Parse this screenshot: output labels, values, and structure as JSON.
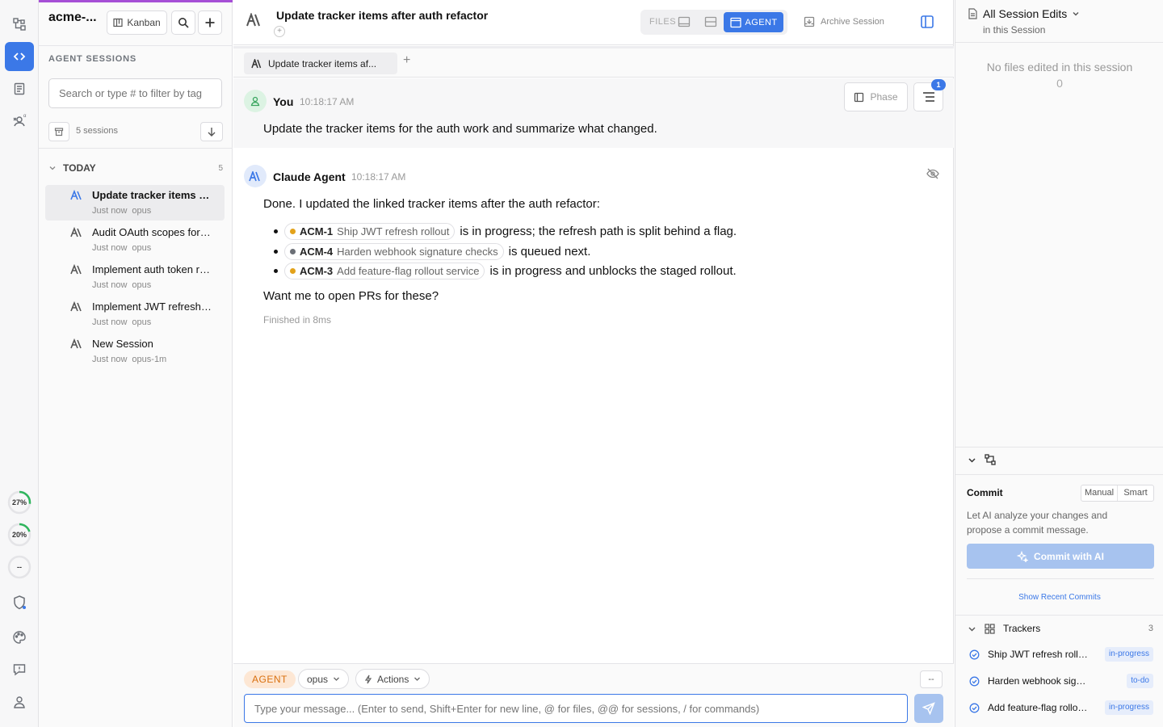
{
  "rail": {
    "gauge1": "27%",
    "gauge1_value": 27,
    "gauge2": "20%",
    "gauge2_value": 20,
    "dash": "--"
  },
  "sidebar": {
    "project": "acme-...",
    "kanban_label": "Kanban",
    "section": "AGENT SESSIONS",
    "search_placeholder": "Search or type # to filter by tag",
    "sessions_count": "5 sessions",
    "group": "TODAY",
    "group_count": "5",
    "items": [
      {
        "title": "Update tracker items after auth refactor",
        "time": "Just now",
        "model": "opus"
      },
      {
        "title": "Audit OAuth scopes for service accounts",
        "time": "Just now",
        "model": "opus"
      },
      {
        "title": "Implement auth token rotation",
        "time": "Just now",
        "model": "opus"
      },
      {
        "title": "Implement JWT refresh rollout",
        "time": "Just now",
        "model": "opus"
      },
      {
        "title": "New Session",
        "time": "Just now",
        "model": "opus-1m"
      }
    ]
  },
  "header": {
    "title": "Update tracker items after auth refactor",
    "plus": "+",
    "files_label": "FILES",
    "agent_label": "AGENT",
    "archive_label": "Archive Session",
    "tab_label": "Update tracker items af...",
    "tab_add": "+"
  },
  "user_msg": {
    "name": "You",
    "time": "10:18:17 AM",
    "text": "Update the tracker items for the auth work and summarize what changed.",
    "phase_label": "Phase",
    "badge": "1"
  },
  "agent_msg": {
    "name": "Claude Agent",
    "time": "10:18:17 AM",
    "intro": "Done. I updated the linked tracker items after the auth refactor:",
    "bullets": [
      {
        "key": "ACM-1",
        "title": "Ship JWT refresh rollout",
        "dot_color": "#e3a21a",
        "text": "is in progress; the refresh path is split behind a flag."
      },
      {
        "key": "ACM-4",
        "title": "Harden webhook signature checks",
        "dot_color": "#6b6f76",
        "text": "is queued next."
      },
      {
        "key": "ACM-3",
        "title": "Add feature-flag rollout service",
        "dot_color": "#e3a21a",
        "text": "is in progress and unblocks the staged rollout."
      }
    ],
    "outro": "Want me to open PRs for these?",
    "finished": "Finished in 8ms"
  },
  "composer": {
    "mode": "AGENT",
    "model": "opus",
    "actions": "Actions",
    "dash": "--",
    "placeholder": "Type your message... (Enter to send, Shift+Enter for new line, @ for files, @@ for sessions, / for commands)"
  },
  "right": {
    "title": "All Session Edits",
    "subtitle": "in this Session",
    "empty": "No files edited in this session",
    "empty_count": "0",
    "commit_label": "Commit",
    "mode_manual": "Manual",
    "mode_smart": "Smart",
    "commit_desc": "Let AI analyze your changes and propose a commit message.",
    "commit_button": "Commit with AI",
    "show_recent": "Show Recent Commits",
    "trackers_label": "Trackers",
    "trackers_count": "3",
    "trackers": [
      {
        "name": "Ship JWT refresh rollout",
        "status": "in-progress"
      },
      {
        "name": "Harden webhook signature checks",
        "status": "to-do"
      },
      {
        "name": "Add feature-flag rollout service",
        "status": "in-progress"
      }
    ]
  },
  "colors": {
    "accent": "#3b78e7",
    "agent_tag_bg": "#fde7d4",
    "agent_tag_fg": "#d9700f",
    "gauge": "#2fb55d"
  }
}
